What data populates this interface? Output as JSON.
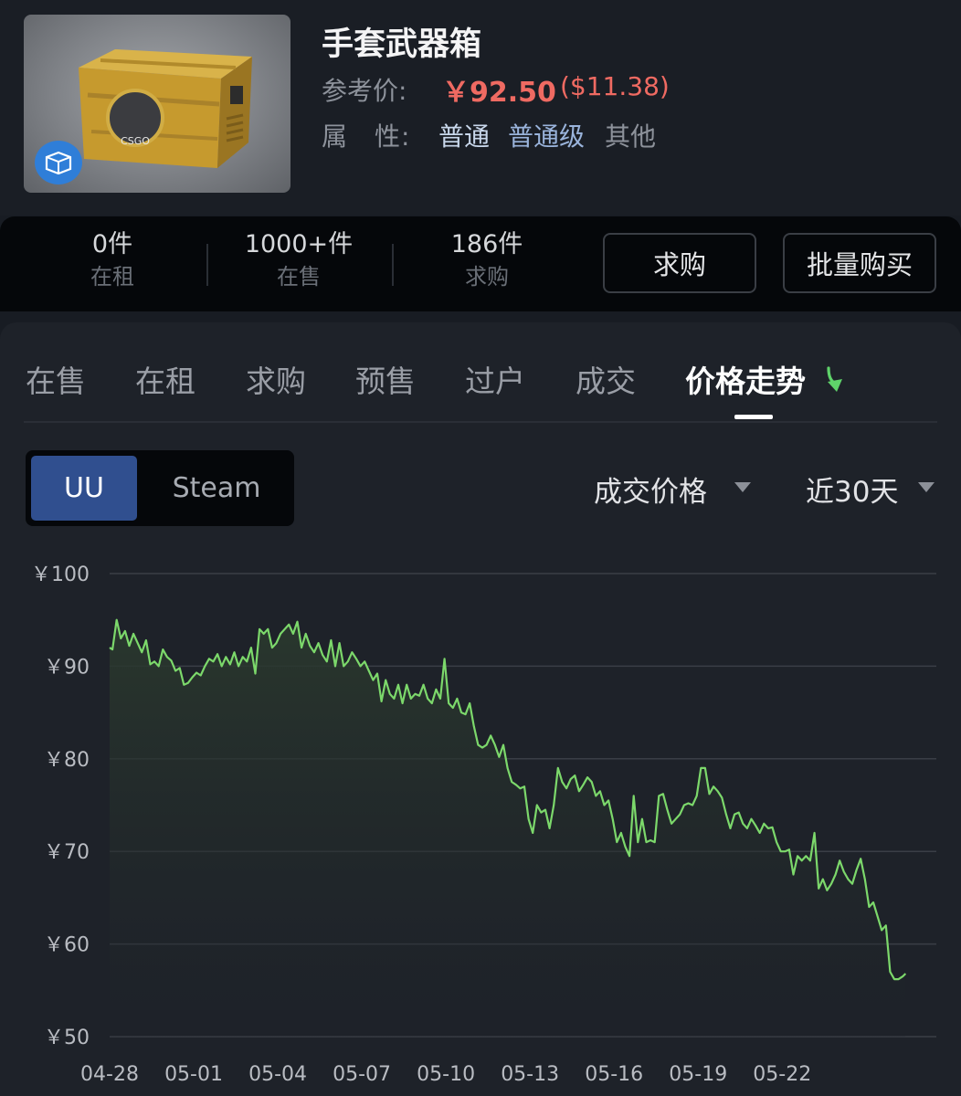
{
  "item": {
    "name": "手套武器箱",
    "ref_label": "参考价:",
    "ref_price": "￥92.50",
    "ref_usd": "($11.38)",
    "attr_label": "属　性:",
    "attrs": [
      {
        "text": "普通",
        "color": "#c9d8ec"
      },
      {
        "text": "普通级",
        "color": "#9ab4dc"
      },
      {
        "text": "其他",
        "color": "#8d929b"
      }
    ],
    "image_icon": "weapon-case-image",
    "badge_icon": "box-icon",
    "crate_text": "CSGO"
  },
  "stats": [
    {
      "num": "0件",
      "label": "在租"
    },
    {
      "num": "1000+件",
      "label": "在售"
    },
    {
      "num": "186件",
      "label": "求购"
    }
  ],
  "buttons": {
    "buy_request": "求购",
    "bulk_buy": "批量购买"
  },
  "tabs": [
    {
      "label": "在售"
    },
    {
      "label": "在租"
    },
    {
      "label": "求购"
    },
    {
      "label": "预售"
    },
    {
      "label": "过户"
    },
    {
      "label": "成交"
    },
    {
      "label": "价格走势"
    }
  ],
  "segment": {
    "uu": "UU",
    "steam": "Steam"
  },
  "dropdowns": {
    "metric": "成交价格",
    "range": "近30天"
  },
  "colors": {
    "accent_red": "#ef6a62",
    "line_green": "#7cd86b",
    "uu_blue": "#304f8f"
  },
  "chart_data": {
    "type": "line",
    "title": "",
    "xlabel": "",
    "ylabel": "",
    "ylim": [
      50,
      100
    ],
    "yticks": [
      100,
      90,
      80,
      70,
      60,
      50
    ],
    "ytick_labels": [
      "￥100",
      "￥90",
      "￥80",
      "￥70",
      "￥60",
      "￥50"
    ],
    "xticks": [
      "04-28",
      "05-01",
      "05-04",
      "05-07",
      "05-10",
      "05-13",
      "05-16",
      "05-19",
      "05-22"
    ],
    "x_end_day": 29.5,
    "grid": true,
    "series": [
      {
        "values": [
          [
            0.0,
            92.0
          ],
          [
            0.1,
            91.8
          ],
          [
            0.25,
            95.0
          ],
          [
            0.4,
            93.0
          ],
          [
            0.55,
            93.8
          ],
          [
            0.7,
            92.2
          ],
          [
            0.85,
            93.5
          ],
          [
            1.0,
            92.5
          ],
          [
            1.15,
            91.5
          ],
          [
            1.3,
            92.8
          ],
          [
            1.45,
            90.2
          ],
          [
            1.6,
            90.5
          ],
          [
            1.75,
            90.0
          ],
          [
            1.9,
            91.8
          ],
          [
            2.05,
            91.0
          ],
          [
            2.2,
            90.6
          ],
          [
            2.35,
            89.5
          ],
          [
            2.5,
            89.8
          ],
          [
            2.65,
            88.0
          ],
          [
            2.8,
            88.2
          ],
          [
            2.95,
            88.8
          ],
          [
            3.1,
            89.3
          ],
          [
            3.25,
            89.0
          ],
          [
            3.4,
            90.0
          ],
          [
            3.55,
            90.8
          ],
          [
            3.7,
            90.5
          ],
          [
            3.85,
            91.3
          ],
          [
            4.0,
            90.0
          ],
          [
            4.15,
            91.0
          ],
          [
            4.3,
            90.2
          ],
          [
            4.45,
            91.5
          ],
          [
            4.6,
            90.0
          ],
          [
            4.75,
            91.0
          ],
          [
            4.9,
            90.5
          ],
          [
            5.05,
            92.0
          ],
          [
            5.2,
            89.2
          ],
          [
            5.35,
            94.0
          ],
          [
            5.5,
            93.5
          ],
          [
            5.65,
            94.0
          ],
          [
            5.8,
            92.0
          ],
          [
            5.95,
            92.5
          ],
          [
            6.1,
            93.5
          ],
          [
            6.25,
            94.0
          ],
          [
            6.4,
            94.5
          ],
          [
            6.55,
            93.5
          ],
          [
            6.7,
            94.8
          ],
          [
            6.85,
            92.0
          ],
          [
            7.0,
            93.5
          ],
          [
            7.15,
            92.2
          ],
          [
            7.3,
            91.5
          ],
          [
            7.45,
            92.5
          ],
          [
            7.6,
            91.2
          ],
          [
            7.75,
            90.5
          ],
          [
            7.9,
            92.8
          ],
          [
            8.05,
            90.0
          ],
          [
            8.2,
            92.5
          ],
          [
            8.35,
            90.0
          ],
          [
            8.5,
            90.5
          ],
          [
            8.65,
            91.5
          ],
          [
            8.8,
            90.8
          ],
          [
            8.95,
            90.0
          ],
          [
            9.1,
            90.5
          ],
          [
            9.25,
            89.5
          ],
          [
            9.4,
            88.5
          ],
          [
            9.55,
            89.2
          ],
          [
            9.7,
            86.2
          ],
          [
            9.85,
            88.5
          ],
          [
            10.0,
            87.0
          ],
          [
            10.15,
            86.5
          ],
          [
            10.3,
            88.0
          ],
          [
            10.45,
            86.0
          ],
          [
            10.6,
            88.0
          ],
          [
            10.75,
            86.5
          ],
          [
            10.9,
            87.0
          ],
          [
            11.05,
            86.8
          ],
          [
            11.2,
            88.0
          ],
          [
            11.35,
            86.5
          ],
          [
            11.5,
            86.0
          ],
          [
            11.65,
            87.5
          ],
          [
            11.8,
            86.5
          ],
          [
            11.95,
            90.8
          ],
          [
            12.1,
            86.0
          ],
          [
            12.25,
            85.5
          ],
          [
            12.4,
            86.5
          ],
          [
            12.55,
            85.0
          ],
          [
            12.7,
            84.8
          ],
          [
            12.85,
            86.0
          ],
          [
            13.0,
            83.5
          ],
          [
            13.15,
            81.5
          ],
          [
            13.3,
            81.2
          ],
          [
            13.45,
            81.5
          ],
          [
            13.6,
            82.5
          ],
          [
            13.75,
            81.5
          ],
          [
            13.9,
            80.2
          ],
          [
            14.05,
            81.5
          ],
          [
            14.2,
            79.0
          ],
          [
            14.35,
            77.5
          ],
          [
            14.5,
            77.2
          ],
          [
            14.65,
            76.8
          ],
          [
            14.8,
            77.0
          ],
          [
            14.95,
            73.5
          ],
          [
            15.1,
            72.0
          ],
          [
            15.25,
            75.0
          ],
          [
            15.4,
            74.2
          ],
          [
            15.55,
            74.5
          ],
          [
            15.7,
            72.5
          ],
          [
            15.85,
            75.0
          ],
          [
            16.0,
            79.0
          ],
          [
            16.15,
            77.5
          ],
          [
            16.3,
            76.8
          ],
          [
            16.45,
            77.8
          ],
          [
            16.6,
            78.2
          ],
          [
            16.75,
            76.5
          ],
          [
            16.9,
            77.2
          ],
          [
            17.05,
            78.0
          ],
          [
            17.2,
            77.5
          ],
          [
            17.35,
            76.0
          ],
          [
            17.5,
            76.5
          ],
          [
            17.65,
            75.0
          ],
          [
            17.8,
            75.5
          ],
          [
            17.95,
            73.5
          ],
          [
            18.1,
            71.0
          ],
          [
            18.25,
            72.0
          ],
          [
            18.4,
            70.5
          ],
          [
            18.55,
            69.5
          ],
          [
            18.7,
            76.0
          ],
          [
            18.85,
            71.0
          ],
          [
            19.0,
            73.5
          ],
          [
            19.15,
            71.0
          ],
          [
            19.3,
            71.2
          ],
          [
            19.45,
            71.0
          ],
          [
            19.6,
            76.0
          ],
          [
            19.75,
            76.2
          ],
          [
            19.9,
            74.5
          ],
          [
            20.05,
            73.0
          ],
          [
            20.2,
            73.5
          ],
          [
            20.35,
            74.0
          ],
          [
            20.5,
            75.0
          ],
          [
            20.65,
            75.2
          ],
          [
            20.8,
            75.0
          ],
          [
            20.95,
            76.0
          ],
          [
            21.1,
            79.0
          ],
          [
            21.25,
            79.0
          ],
          [
            21.4,
            76.2
          ],
          [
            21.55,
            77.0
          ],
          [
            21.7,
            76.5
          ],
          [
            21.85,
            75.8
          ],
          [
            22.0,
            74.0
          ],
          [
            22.15,
            72.5
          ],
          [
            22.3,
            74.0
          ],
          [
            22.45,
            74.2
          ],
          [
            22.6,
            73.0
          ],
          [
            22.75,
            72.5
          ],
          [
            22.9,
            73.5
          ],
          [
            23.05,
            72.8
          ],
          [
            23.2,
            72.0
          ],
          [
            23.35,
            73.0
          ],
          [
            23.5,
            72.5
          ],
          [
            23.65,
            72.6
          ],
          [
            23.8,
            71.0
          ],
          [
            23.95,
            70.0
          ],
          [
            24.1,
            70.0
          ],
          [
            24.25,
            70.2
          ],
          [
            24.4,
            67.5
          ],
          [
            24.55,
            69.5
          ],
          [
            24.7,
            69.0
          ],
          [
            24.85,
            69.5
          ],
          [
            25.0,
            69.0
          ],
          [
            25.15,
            72.0
          ],
          [
            25.3,
            66.0
          ],
          [
            25.45,
            67.0
          ],
          [
            25.6,
            65.8
          ],
          [
            25.75,
            66.5
          ],
          [
            25.9,
            67.5
          ],
          [
            26.05,
            69.0
          ],
          [
            26.2,
            67.8
          ],
          [
            26.35,
            67.0
          ],
          [
            26.5,
            66.5
          ],
          [
            26.65,
            68.0
          ],
          [
            26.8,
            69.2
          ],
          [
            26.95,
            67.0
          ],
          [
            27.1,
            64.0
          ],
          [
            27.25,
            64.5
          ],
          [
            27.4,
            63.0
          ],
          [
            27.55,
            61.5
          ],
          [
            27.7,
            62.0
          ],
          [
            27.85,
            57.0
          ],
          [
            28.0,
            56.2
          ],
          [
            28.15,
            56.2
          ],
          [
            28.3,
            56.5
          ],
          [
            28.4,
            56.8
          ]
        ]
      }
    ]
  }
}
